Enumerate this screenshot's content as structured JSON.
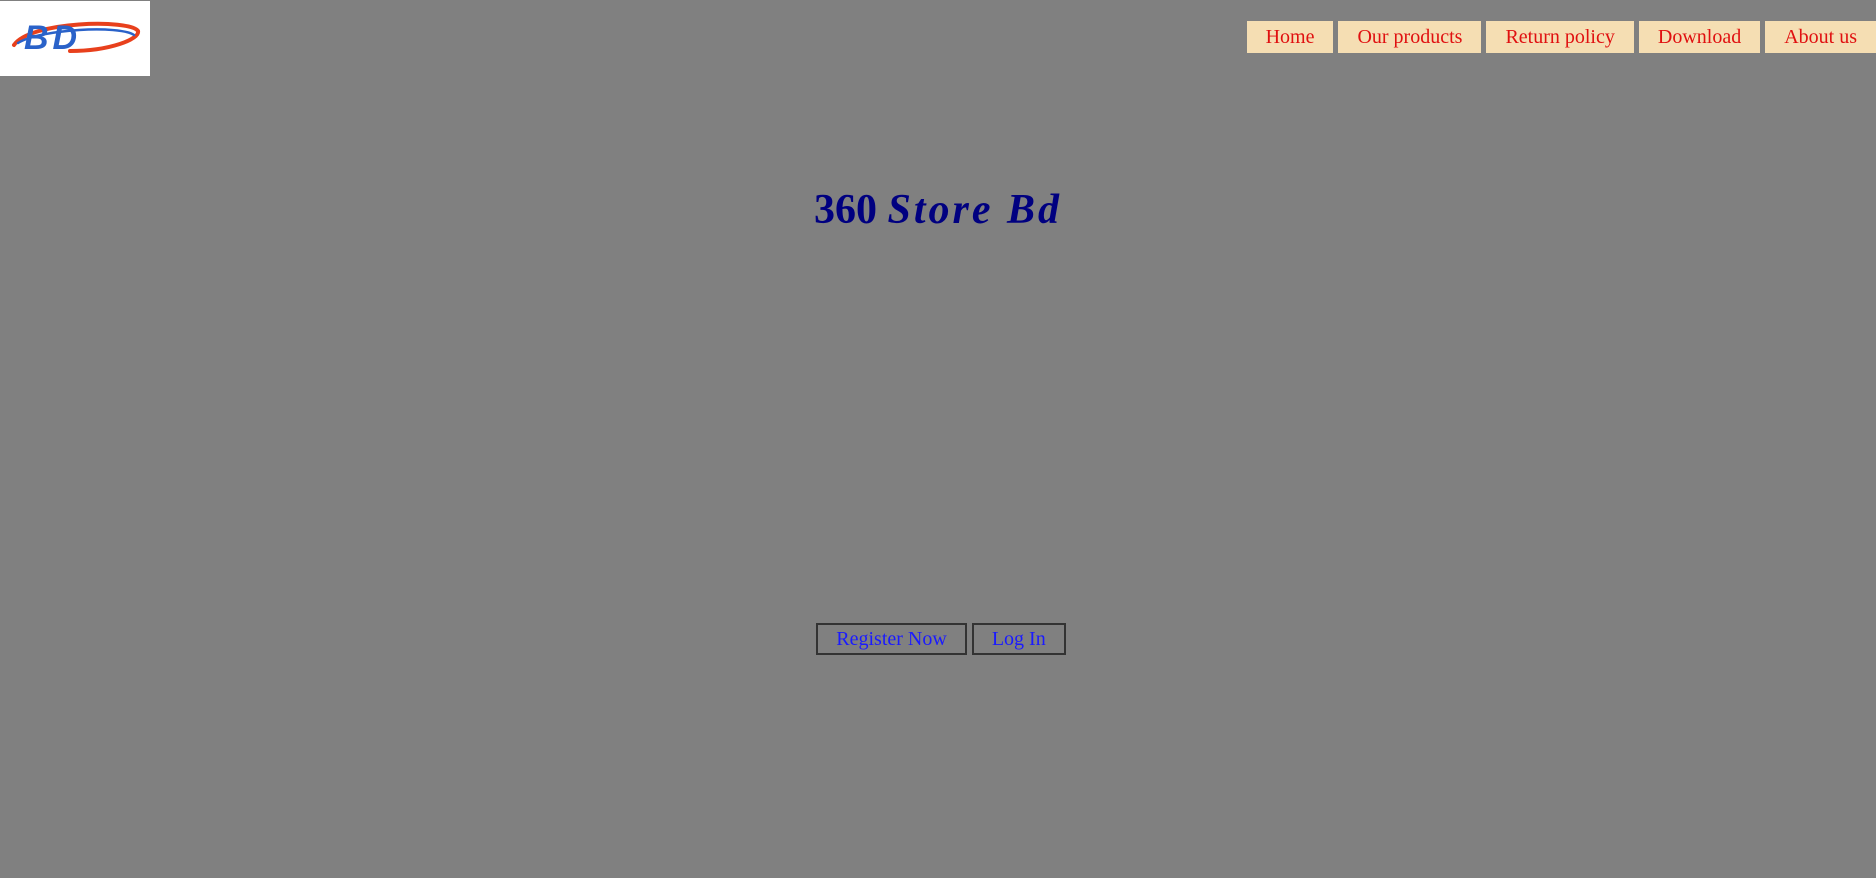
{
  "brand": {
    "logo_text": "BD",
    "title_prefix": "360",
    "title_script": "Store Bd"
  },
  "nav": {
    "items": [
      {
        "label": "Home"
      },
      {
        "label": "Our products"
      },
      {
        "label": "Return policy"
      },
      {
        "label": "Download"
      },
      {
        "label": "About us"
      }
    ]
  },
  "actions": {
    "register_label": "Register Now",
    "login_label": "Log In"
  },
  "colors": {
    "background": "#808080",
    "nav_bg": "#f5deb3",
    "nav_text": "#e01010",
    "title": "#000080",
    "button_text": "#1a1aff"
  }
}
